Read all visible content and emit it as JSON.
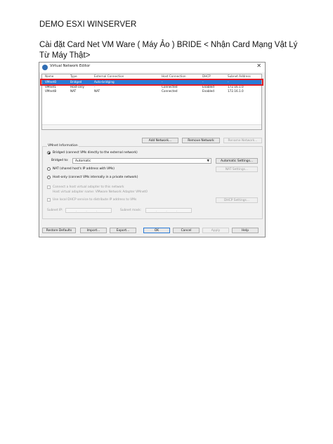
{
  "doc": {
    "title": "DEMO ESXI WINSERVER",
    "paragraph": "Cài đặt Card Net VM Ware ( Máy Ảo ) BRIDE < Nhận Card Mạng Vật Lý Từ Máy Thật>"
  },
  "window": {
    "title": "Virtual Network Editor",
    "close_glyph": "✕",
    "table": {
      "headers": [
        "Name",
        "Type",
        "External Connection",
        "Host Connection",
        "DHCP",
        "Subnet Address"
      ],
      "rows": [
        [
          "VMnet0",
          "Bridged",
          "Auto-bridging",
          "-",
          "-",
          "-"
        ],
        [
          "VMnet1",
          "Host-only",
          "-",
          "Connected",
          "Enabled",
          "172.16.1.0"
        ],
        [
          "VMnet8",
          "NAT",
          "NAT",
          "Connected",
          "Enabled",
          "172.16.1.0"
        ]
      ],
      "selected_row": 0
    },
    "buttons": {
      "add_network": "Add Network...",
      "remove_network": "Remove Network",
      "rename_network": "Rename Network...",
      "automatic_settings": "Automatic Settings...",
      "nat_settings": "NAT Settings...",
      "dhcp_settings": "DHCP Settings...",
      "restore_defaults": "Restore Defaults",
      "import": "Import...",
      "export": "Export...",
      "ok": "OK",
      "cancel": "Cancel",
      "apply": "Apply",
      "help": "Help"
    },
    "vmnet_info": {
      "label": "VMnet Information",
      "bridged": "Bridged (connect VMs directly to the external network)",
      "bridged_to_label": "Bridged to:",
      "bridged_to_value": "Automatic",
      "nat": "NAT (shared host's IP address with VMs)",
      "host_only": "Host-only (connect VMs internally in a private network)",
      "connect_adapter": "Connect a host virtual adapter to this network",
      "adapter_name": "Host virtual adapter name: VMware Network Adapter VMnet0",
      "use_dhcp": "Use local DHCP service to distribute IP address to VMs",
      "subnet_ip_label": "Subnet IP:",
      "subnet_mask_label": "Subnet mask:",
      "ip_placeholder": ". . .",
      "selected_mode": "bridged"
    }
  }
}
